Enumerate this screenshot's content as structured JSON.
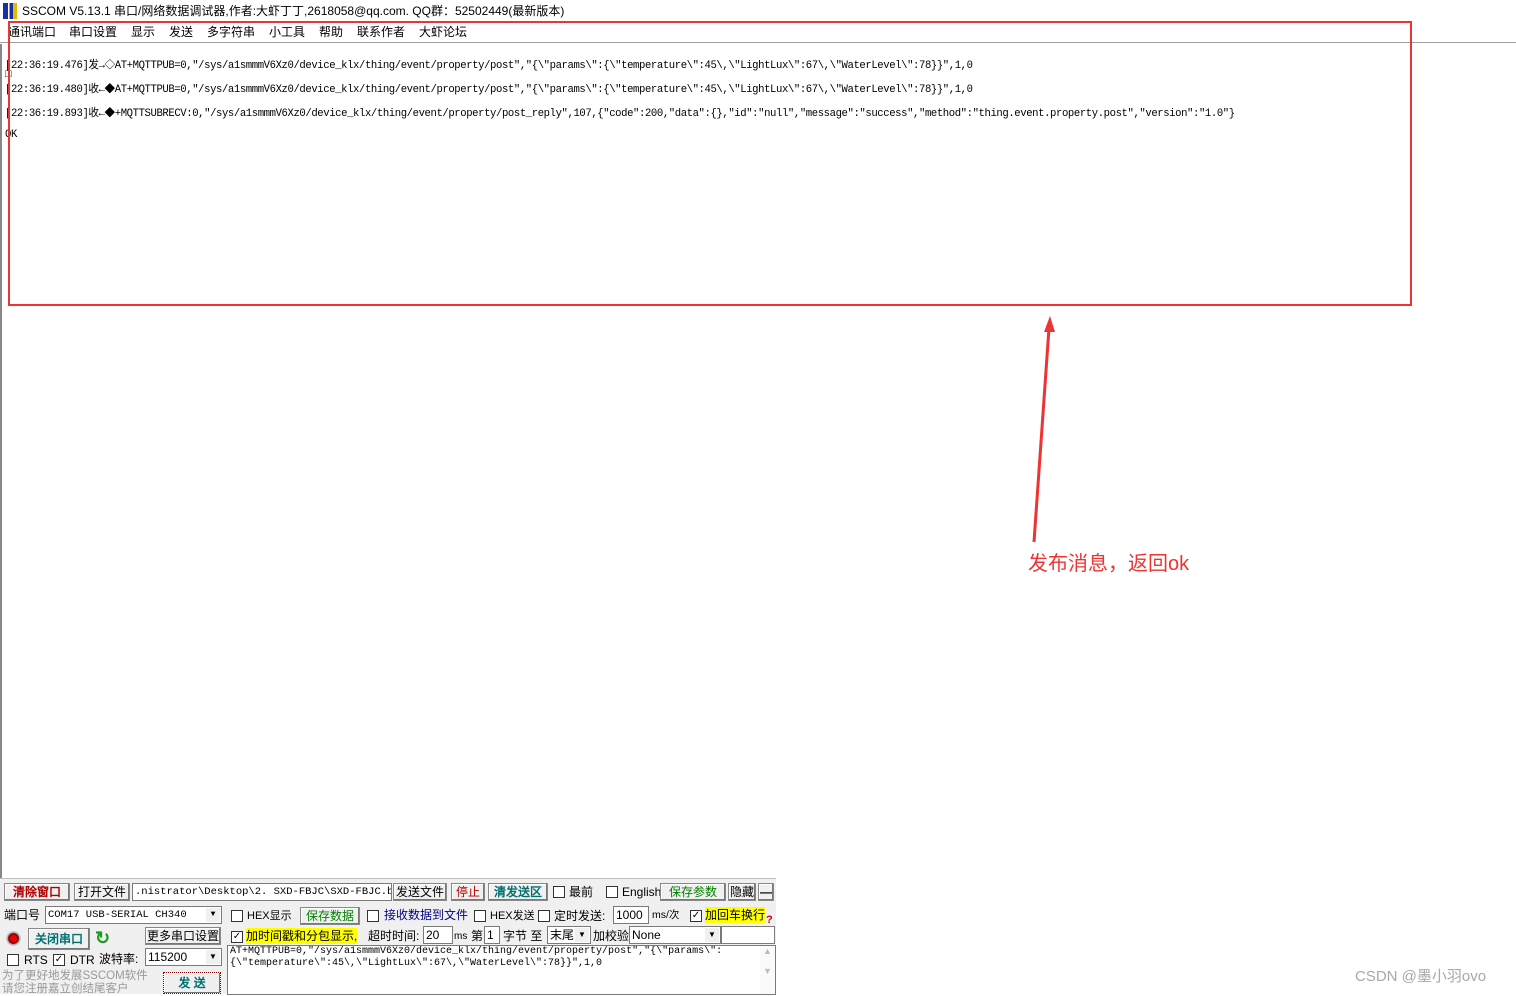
{
  "window": {
    "title": "SSCOM V5.13.1 串口/网络数据调试器,作者:大虾丁丁,2618058@qq.com. QQ群：52502449(最新版本)"
  },
  "menu": [
    "通讯端口",
    "串口设置",
    "显示",
    "发送",
    "多字符串",
    "小工具",
    "帮助",
    "联系作者",
    "大虾论坛"
  ],
  "log": [
    "[22:36:19.476]发→◇AT+MQTTPUB=0,\"/sys/a1smmmV6Xz0/device_klx/thing/event/property/post\",\"{\\\"params\\\":{\\\"temperature\\\":45\\,\\\"LightLux\\\":67\\,\\\"WaterLevel\\\":78}}\",1,0",
    "□",
    "[22:36:19.480]收←◆AT+MQTTPUB=0,\"/sys/a1smmmV6Xz0/device_klx/thing/event/property/post\",\"{\\\"params\\\":{\\\"temperature\\\":45\\,\\\"LightLux\\\":67\\,\\\"WaterLevel\\\":78}}\",1,0",
    "[22:36:19.893]收←◆+MQTTSUBRECV:0,\"/sys/a1smmmV6Xz0/device_klx/thing/event/property/post_reply\",107,{\"code\":200,\"data\":{},\"id\":\"null\",\"message\":\"success\",\"method\":\"thing.event.property.post\",\"version\":\"1.0\"}",
    "OK"
  ],
  "annotation": {
    "text": "发布消息，返回ok",
    "color": "#ee3333"
  },
  "watermark": "CSDN @墨小羽ovo",
  "toolbar": {
    "clear": "清除窗口",
    "open_file": "打开文件",
    "file_path": ".nistrator\\Desktop\\2. SXD-FBJC\\SXD-FBJC.bin",
    "send_file": "发送文件",
    "stop": "停止",
    "clear_send": "清发送区",
    "topmost": "最前",
    "english": "English",
    "save_params": "保存参数",
    "hide": "隐藏",
    "minus": "—"
  },
  "serial": {
    "port_label": "端口号",
    "port_value": "COM17 USB-SERIAL CH340",
    "close_port": "关闭串口",
    "more_settings": "更多串口设置",
    "rts": "RTS",
    "dtr": "DTR",
    "baud_label": "波特率:",
    "baud_value": "115200",
    "promo": "为了更好地发展SSCOM软件\n请您注册嘉立创结尾客户",
    "send": "发  送"
  },
  "options": {
    "hex_display": "HEX显示",
    "save_data": "保存数据",
    "recv_to_file": "接收数据到文件",
    "hex_send": "HEX发送",
    "timed_send": "定时发送:",
    "interval": "1000",
    "interval_unit": "ms/次",
    "add_crlf": "加回车换行",
    "timestamp": "加时间戳和分包显示,",
    "timeout_label": "超时时间:",
    "timeout": "20",
    "timeout_unit": "ms",
    "byte_from_label": "第",
    "byte_from": "1",
    "byte_unit": "字节 至",
    "byte_to": "末尾",
    "checksum_label": "加校验",
    "checksum": "None",
    "help": "?"
  },
  "checked": {
    "dtr": true,
    "timestamp": true,
    "add_crlf": true,
    "rts": false,
    "hex_display": false,
    "recv_to_file": false,
    "hex_send": false,
    "timed_send": false,
    "topmost": false,
    "english": false
  },
  "send_text": "AT+MQTTPUB=0,\"/sys/a1smmmV6Xz0/device_klx/thing/event/property/post\",\"{\\\"params\\\":\n{\\\"temperature\\\":45\\,\\\"LightLux\\\":67\\,\\\"WaterLevel\\\":78}}\",1,0"
}
